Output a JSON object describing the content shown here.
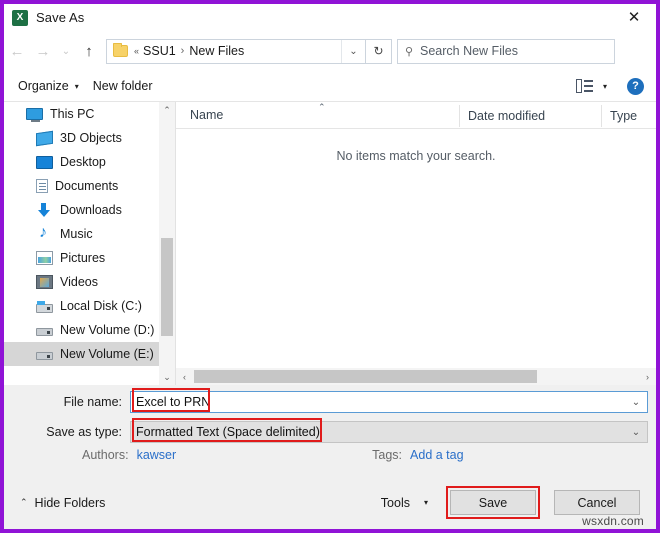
{
  "window": {
    "title": "Save As",
    "app_icon": "excel-icon",
    "close_label": "✕",
    "border_color": "#9013d6"
  },
  "nav": {
    "back": "←",
    "forward": "→",
    "recent": "⌄",
    "up": "↑",
    "refresh": "↻",
    "address": {
      "folder_icon": "folder-icon",
      "overflow": "«",
      "crumbs": [
        "SSU1",
        "New Files"
      ],
      "separator": "›",
      "dropdown": "⌄"
    },
    "search": {
      "icon": "search-icon",
      "placeholder": "Search New Files",
      "value": ""
    }
  },
  "toolbar": {
    "organize_label": "Organize",
    "organize_caret": "▾",
    "new_folder_label": "New folder",
    "view_caret": "▾",
    "help_label": "?"
  },
  "sidebar": {
    "items": [
      {
        "label": "This PC",
        "icon": "pc-icon",
        "level": "root",
        "selected": false
      },
      {
        "label": "3D Objects",
        "icon": "cube-icon",
        "level": "child",
        "selected": false
      },
      {
        "label": "Desktop",
        "icon": "desktop-icon",
        "level": "child",
        "selected": false
      },
      {
        "label": "Documents",
        "icon": "documents-icon",
        "level": "child",
        "selected": false
      },
      {
        "label": "Downloads",
        "icon": "downloads-icon",
        "level": "child",
        "selected": false
      },
      {
        "label": "Music",
        "icon": "music-icon",
        "level": "child",
        "selected": false
      },
      {
        "label": "Pictures",
        "icon": "pictures-icon",
        "level": "child",
        "selected": false
      },
      {
        "label": "Videos",
        "icon": "videos-icon",
        "level": "child",
        "selected": false
      },
      {
        "label": "Local Disk (C:)",
        "icon": "local-disk-icon",
        "level": "child",
        "selected": false
      },
      {
        "label": "New Volume (D:)",
        "icon": "drive-icon",
        "level": "child",
        "selected": false
      },
      {
        "label": "New Volume (E:)",
        "icon": "drive-icon",
        "level": "child",
        "selected": true
      }
    ],
    "scroll_up": "⌃",
    "scroll_down": "⌄"
  },
  "filelist": {
    "columns": [
      "Name",
      "Date modified",
      "Type"
    ],
    "sort_indicator": "⌃",
    "empty_message": "No items match your search.",
    "rows": [],
    "hscroll_left": "‹",
    "hscroll_right": "›"
  },
  "form": {
    "file_name": {
      "label": "File name:",
      "value": "Excel to PRN",
      "dropdown": "⌄",
      "highlighted": true
    },
    "save_as_type": {
      "label": "Save as type:",
      "value": "Formatted Text (Space delimited)",
      "dropdown": "⌄",
      "highlighted": true
    },
    "authors": {
      "label": "Authors:",
      "value": "kawser"
    },
    "tags": {
      "label": "Tags:",
      "value": "Add a tag"
    }
  },
  "footer": {
    "hide_folders_label": "Hide Folders",
    "hide_folders_chevron": "⌃",
    "tools_label": "Tools",
    "tools_caret": "▾",
    "save_label": "Save",
    "cancel_label": "Cancel",
    "save_highlighted": true
  },
  "watermark": {
    "text": "wsxdn.com"
  },
  "colors": {
    "frame_purple": "#9013d6",
    "highlight_red": "#e01b1b",
    "focus_blue": "#5a9bd5",
    "link_blue": "#2a6fc9",
    "selection_grey": "#d6d6d6"
  }
}
